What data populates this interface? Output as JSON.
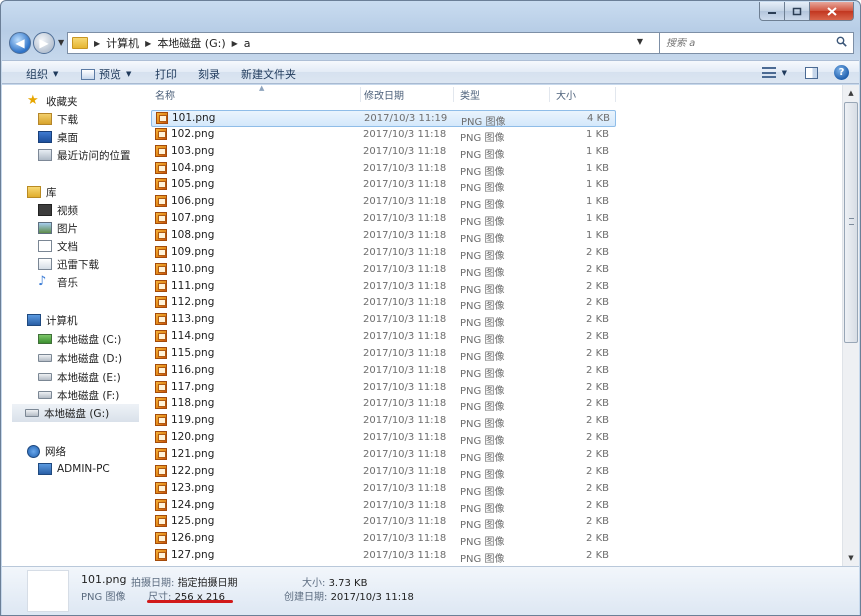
{
  "address": {
    "breadcrumbs": [
      "计算机",
      "本地磁盘 (G:)",
      "a"
    ],
    "search_placeholder": "搜索 a"
  },
  "toolbar": {
    "organize": "组织",
    "preview": "预览",
    "print": "打印",
    "burn": "刻录",
    "new_folder": "新建文件夹"
  },
  "sidebar": {
    "favorites": {
      "label": "收藏夹",
      "items": [
        "下载",
        "桌面",
        "最近访问的位置"
      ]
    },
    "libraries": {
      "label": "库",
      "items": [
        "视频",
        "图片",
        "文档",
        "迅雷下载",
        "音乐"
      ]
    },
    "computer": {
      "label": "计算机",
      "drives": [
        "本地磁盘 (C:)",
        "本地磁盘 (D:)",
        "本地磁盘 (E:)",
        "本地磁盘 (F:)",
        "本地磁盘 (G:)"
      ]
    },
    "network": {
      "label": "网络",
      "items": [
        "ADMIN-PC"
      ]
    }
  },
  "columns": {
    "name": "名称",
    "date": "修改日期",
    "type": "类型",
    "size": "大小"
  },
  "files": [
    {
      "name": "101.png",
      "date": "2017/10/3 11:19",
      "type": "PNG 图像",
      "size": "4 KB"
    },
    {
      "name": "102.png",
      "date": "2017/10/3 11:18",
      "type": "PNG 图像",
      "size": "1 KB"
    },
    {
      "name": "103.png",
      "date": "2017/10/3 11:18",
      "type": "PNG 图像",
      "size": "1 KB"
    },
    {
      "name": "104.png",
      "date": "2017/10/3 11:18",
      "type": "PNG 图像",
      "size": "1 KB"
    },
    {
      "name": "105.png",
      "date": "2017/10/3 11:18",
      "type": "PNG 图像",
      "size": "1 KB"
    },
    {
      "name": "106.png",
      "date": "2017/10/3 11:18",
      "type": "PNG 图像",
      "size": "1 KB"
    },
    {
      "name": "107.png",
      "date": "2017/10/3 11:18",
      "type": "PNG 图像",
      "size": "1 KB"
    },
    {
      "name": "108.png",
      "date": "2017/10/3 11:18",
      "type": "PNG 图像",
      "size": "1 KB"
    },
    {
      "name": "109.png",
      "date": "2017/10/3 11:18",
      "type": "PNG 图像",
      "size": "2 KB"
    },
    {
      "name": "110.png",
      "date": "2017/10/3 11:18",
      "type": "PNG 图像",
      "size": "2 KB"
    },
    {
      "name": "111.png",
      "date": "2017/10/3 11:18",
      "type": "PNG 图像",
      "size": "2 KB"
    },
    {
      "name": "112.png",
      "date": "2017/10/3 11:18",
      "type": "PNG 图像",
      "size": "2 KB"
    },
    {
      "name": "113.png",
      "date": "2017/10/3 11:18",
      "type": "PNG 图像",
      "size": "2 KB"
    },
    {
      "name": "114.png",
      "date": "2017/10/3 11:18",
      "type": "PNG 图像",
      "size": "2 KB"
    },
    {
      "name": "115.png",
      "date": "2017/10/3 11:18",
      "type": "PNG 图像",
      "size": "2 KB"
    },
    {
      "name": "116.png",
      "date": "2017/10/3 11:18",
      "type": "PNG 图像",
      "size": "2 KB"
    },
    {
      "name": "117.png",
      "date": "2017/10/3 11:18",
      "type": "PNG 图像",
      "size": "2 KB"
    },
    {
      "name": "118.png",
      "date": "2017/10/3 11:18",
      "type": "PNG 图像",
      "size": "2 KB"
    },
    {
      "name": "119.png",
      "date": "2017/10/3 11:18",
      "type": "PNG 图像",
      "size": "2 KB"
    },
    {
      "name": "120.png",
      "date": "2017/10/3 11:18",
      "type": "PNG 图像",
      "size": "2 KB"
    },
    {
      "name": "121.png",
      "date": "2017/10/3 11:18",
      "type": "PNG 图像",
      "size": "2 KB"
    },
    {
      "name": "122.png",
      "date": "2017/10/3 11:18",
      "type": "PNG 图像",
      "size": "2 KB"
    },
    {
      "name": "123.png",
      "date": "2017/10/3 11:18",
      "type": "PNG 图像",
      "size": "2 KB"
    },
    {
      "name": "124.png",
      "date": "2017/10/3 11:18",
      "type": "PNG 图像",
      "size": "2 KB"
    },
    {
      "name": "125.png",
      "date": "2017/10/3 11:18",
      "type": "PNG 图像",
      "size": "2 KB"
    },
    {
      "name": "126.png",
      "date": "2017/10/3 11:18",
      "type": "PNG 图像",
      "size": "2 KB"
    },
    {
      "name": "127.png",
      "date": "2017/10/3 11:18",
      "type": "PNG 图像",
      "size": "2 KB"
    }
  ],
  "details": {
    "name": "101.png",
    "type": "PNG 图像",
    "date_taken_label": "拍摄日期:",
    "date_taken_value": "指定拍摄日期",
    "dimensions_label": "尺寸:",
    "dimensions_value": "256 x 216",
    "size_label": "大小:",
    "size_value": "3.73 KB",
    "created_label": "创建日期:",
    "created_value": "2017/10/3 11:18"
  },
  "colors": {
    "selection": "#d4e8fb",
    "annotation_underline": "#d11a1a"
  }
}
